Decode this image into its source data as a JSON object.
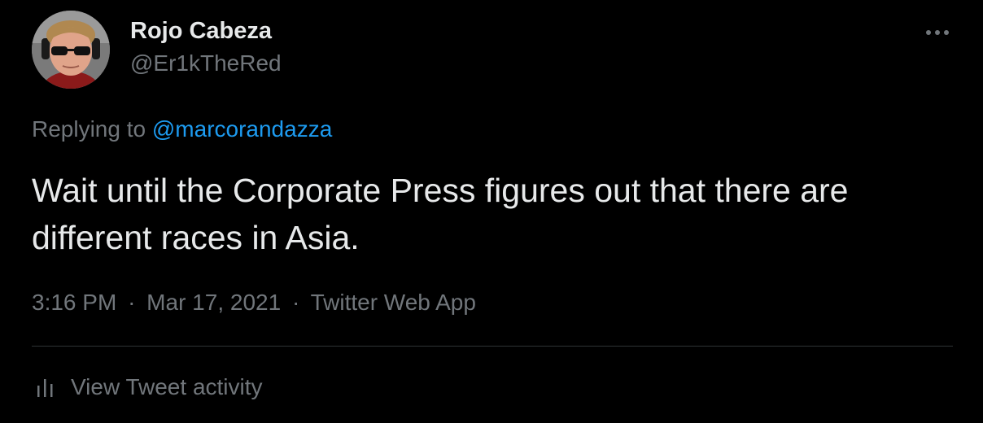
{
  "tweet": {
    "author": {
      "display_name": "Rojo Cabeza",
      "handle": "@Er1kTheRed"
    },
    "reply_prefix": "Replying to",
    "reply_mention": "@marcorandazza",
    "text": "Wait until the Corporate Press figures out that there are different races in Asia.",
    "time": "3:16 PM",
    "date": "Mar 17, 2021",
    "separator": "·",
    "source": "Twitter Web App",
    "activity_label": "View Tweet activity",
    "more_icon": "more-horizontal-icon",
    "activity_icon": "bar-chart-icon"
  },
  "colors": {
    "background": "#000000",
    "text_primary": "#e7e9ea",
    "text_secondary": "#71767b",
    "link": "#1d9bf0",
    "divider": "#2f3336"
  }
}
